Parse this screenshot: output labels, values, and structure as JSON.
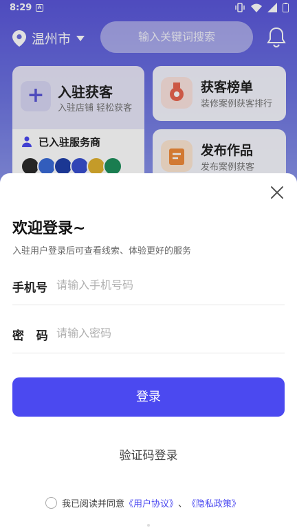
{
  "status_bar": {
    "time": "8:29",
    "app_icon_letter": "A"
  },
  "header": {
    "city": "温州市",
    "search_placeholder": "输入关键词搜索"
  },
  "cards": {
    "join": {
      "title": "入驻获客",
      "subtitle": "入驻店铺  轻松获客"
    },
    "providers": {
      "title": "已入驻服务商",
      "logo_colors": [
        "#2b2b2b",
        "#3a6ad6",
        "#1f3fa8",
        "#3a4fd0",
        "#e0b12f",
        "#1e8f5c"
      ]
    },
    "rank": {
      "title": "获客榜单",
      "subtitle": "装修案例获客排行"
    },
    "publish": {
      "title": "发布作品",
      "subtitle": "发布案例获客"
    }
  },
  "login": {
    "title": "欢迎登录~",
    "description": "入驻用户登录后可查看线索、体验更好的服务",
    "phone_label": "手机号",
    "phone_placeholder": "请输入手机号码",
    "password_label": "密   码",
    "password_placeholder": "请输入密码",
    "login_button": "登录",
    "code_login": "验证码登录",
    "agreement_prefix": "我已阅读并同意",
    "user_agreement": "《用户协议》",
    "separator": "、",
    "privacy_policy": "《隐私政策》"
  },
  "colors": {
    "primary": "#4b49f0",
    "header_gradient_top": "#5a56d9"
  }
}
